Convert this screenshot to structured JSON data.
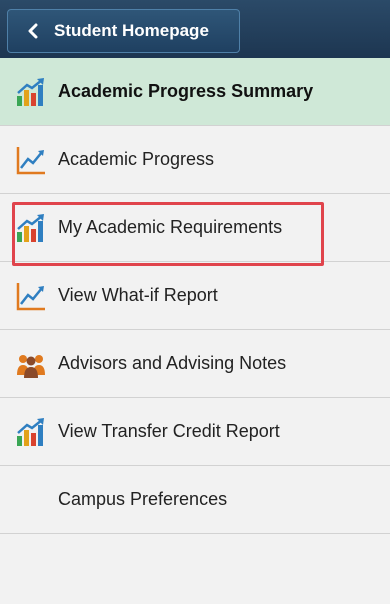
{
  "header": {
    "back_label": "Student Homepage"
  },
  "menu": {
    "items": [
      {
        "label": "Academic Progress Summary",
        "icon": "bar-chart-arrow-icon"
      },
      {
        "label": "Academic Progress",
        "icon": "line-chart-icon"
      },
      {
        "label": "My Academic Requirements",
        "icon": "bar-chart-arrow-icon"
      },
      {
        "label": "View What-if Report",
        "icon": "line-chart-icon"
      },
      {
        "label": "Advisors and Advising Notes",
        "icon": "people-group-icon"
      },
      {
        "label": "View Transfer Credit Report",
        "icon": "bar-chart-arrow-icon"
      },
      {
        "label": "Campus Preferences",
        "icon": ""
      }
    ]
  },
  "colors": {
    "header_bg": "#1d3651",
    "active_bg": "#cfe8d7",
    "highlight_border": "#e0444c"
  }
}
